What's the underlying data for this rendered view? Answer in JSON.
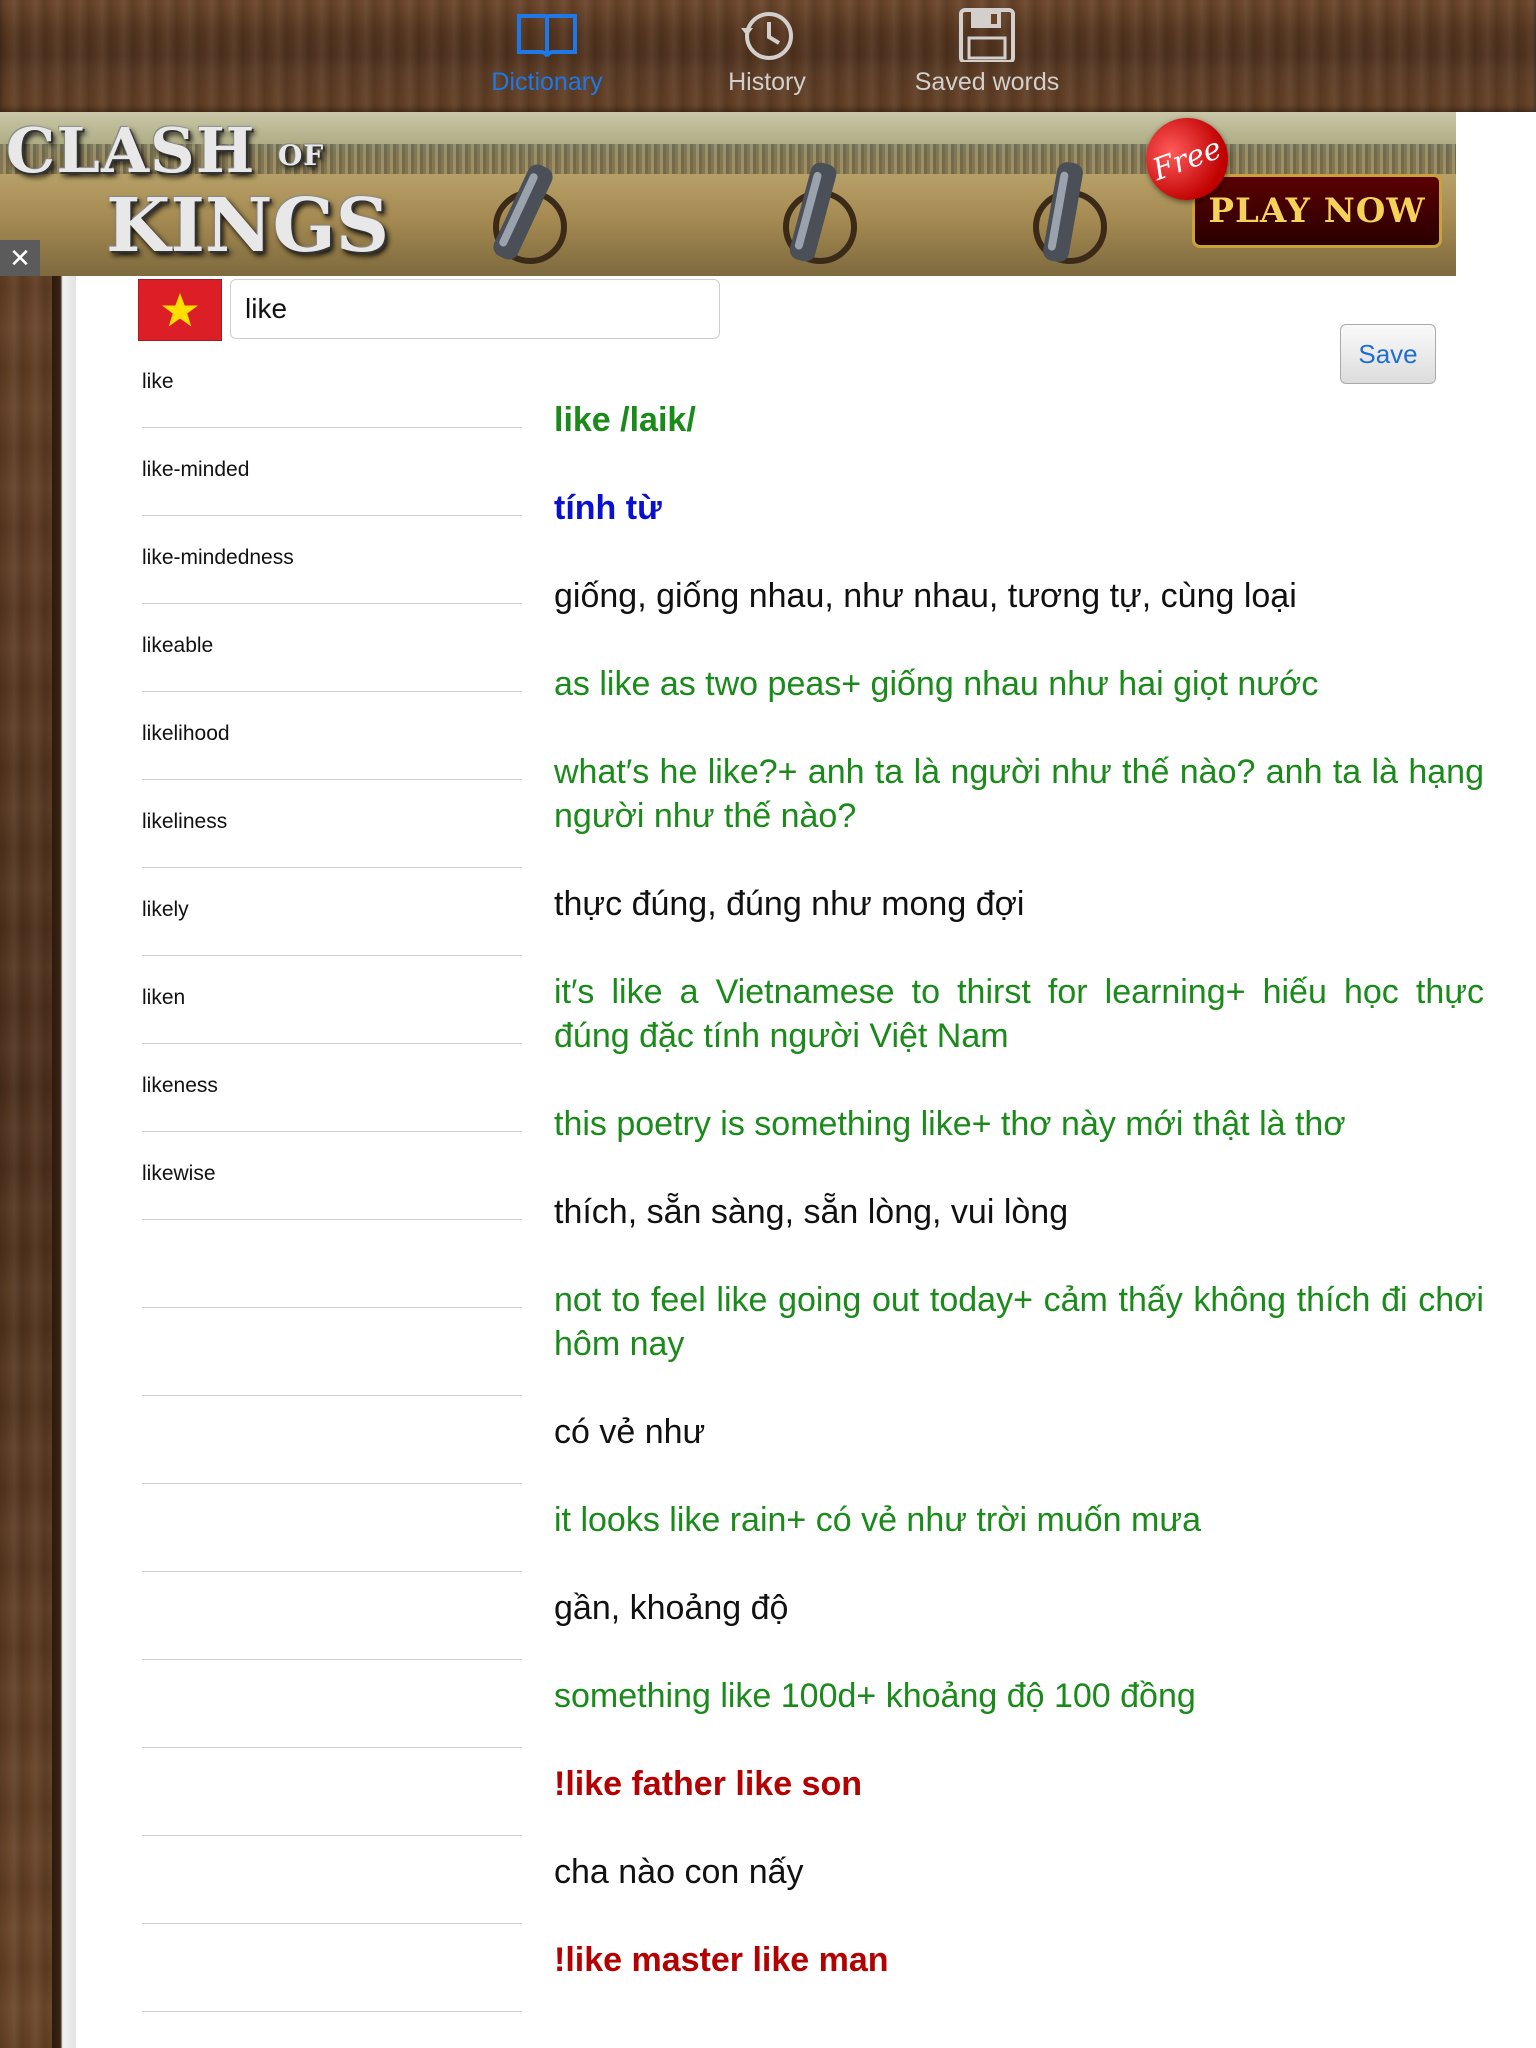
{
  "tabs": [
    {
      "label": "Dictionary",
      "icon": "book-icon",
      "active": true
    },
    {
      "label": "History",
      "icon": "clock-history-icon",
      "active": false
    },
    {
      "label": "Saved words",
      "icon": "floppy-disk-icon",
      "active": false
    }
  ],
  "ad": {
    "logo_line1": "CLASH",
    "logo_of": "OF",
    "logo_line2": "KINGS",
    "badge": "Free",
    "cta": "PLAY NOW",
    "close": "✕"
  },
  "search": {
    "value": "like",
    "flag": "vietnam-flag-icon"
  },
  "save_label": "Save",
  "word_list": [
    "like",
    "like-minded",
    "like-mindedness",
    "likeable",
    "likelihood",
    "likeliness",
    "likely",
    "liken",
    "likeness",
    "likewise",
    "",
    "",
    "",
    "",
    "",
    "",
    "",
    "",
    ""
  ],
  "definition": [
    {
      "type": "headword",
      "text": "like /laik/"
    },
    {
      "type": "pos",
      "text": "tính từ"
    },
    {
      "type": "meaning",
      "text": "giống, giống nhau, như nhau, tương tự, cùng loại"
    },
    {
      "type": "example",
      "text": "as like as two peas+ giống nhau như hai giọt nước"
    },
    {
      "type": "example",
      "text": "what′s he like?+ anh ta là người như thế nào? anh ta là hạng người như thế nào?"
    },
    {
      "type": "meaning",
      "text": "thực đúng, đúng như mong đợi"
    },
    {
      "type": "example",
      "text": "it′s like a Vietnamese to thirst for learning+ hiếu học thực đúng đặc tính người Việt Nam"
    },
    {
      "type": "example",
      "text": "this poetry is something like+ thơ này mới thật là thơ"
    },
    {
      "type": "meaning",
      "text": "thích, sẵn sàng, sẵn lòng, vui lòng"
    },
    {
      "type": "example",
      "text": "not to feel like going out today+ cảm thấy không thích đi chơi hôm nay"
    },
    {
      "type": "meaning",
      "text": "có vẻ như"
    },
    {
      "type": "example",
      "text": "it looks like rain+ có vẻ như trời muốn mưa"
    },
    {
      "type": "meaning",
      "text": "gần, khoảng độ"
    },
    {
      "type": "example",
      "text": "something like 100d+ khoảng độ 100 đồng"
    },
    {
      "type": "idiom",
      "text": "!like father like son"
    },
    {
      "type": "meaning",
      "text": "cha nào con nấy"
    },
    {
      "type": "idiom",
      "text": "!like master like man"
    }
  ],
  "colors": {
    "accent": "#1f78e8",
    "headword": "#1a8a1a",
    "pos": "#0a10d0",
    "idiom": "#b30000"
  }
}
